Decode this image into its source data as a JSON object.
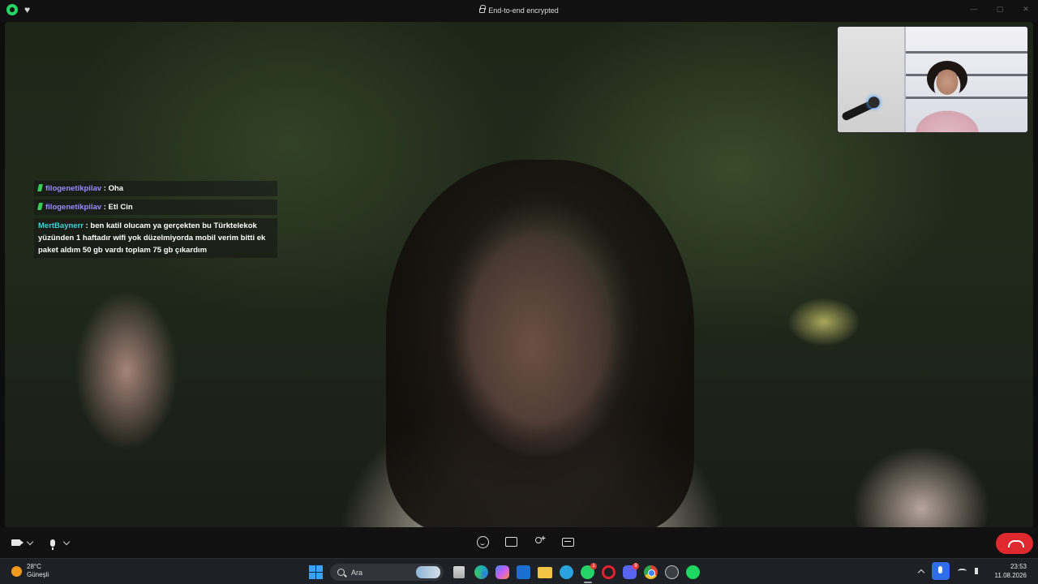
{
  "window": {
    "title": "End-to-end encrypted",
    "app_icon": "whatsapp-icon",
    "secondary_icon": "heart-icon"
  },
  "chat_overlay": {
    "messages": [
      {
        "user": "filogenetikpilav",
        "separator": ":",
        "text": "Oha",
        "user_color": "#9b8cff"
      },
      {
        "user": "filogenetikpilav",
        "separator": ":",
        "text": "Etl Cin",
        "user_color": "#9b8cff"
      },
      {
        "user": "MertBaynerr",
        "separator": ":",
        "text": "ben katil olucam ya gerçekten bu Türktelekok yüzünden 1 haftadır wifi yok düzelmiyorda mobil verim bitti ek paket aldım 50 gb vardı toplam 75 gb çıkardım",
        "user_color": "#3fd4d8"
      }
    ]
  },
  "call_controls": {
    "left": [
      "video-camera-icon",
      "microphone-icon"
    ],
    "center": [
      "emoji-icon",
      "screen-share-icon",
      "add-participant-icon",
      "captions-icon"
    ],
    "end_call_color": "#e0282f"
  },
  "taskbar": {
    "weather": {
      "temp": "28°C",
      "condition": "Güneşli"
    },
    "search_placeholder": "Ara",
    "apps": [
      "files",
      "edge",
      "copilot",
      "outlook",
      "file-explorer",
      "telegram",
      "whatsapp",
      "opera",
      "discord",
      "chrome",
      "misc",
      "spotify"
    ],
    "badges": {
      "whatsapp": "1",
      "discord": "9"
    },
    "clock": {
      "time": "23:53",
      "date": "11.08.2026"
    }
  }
}
